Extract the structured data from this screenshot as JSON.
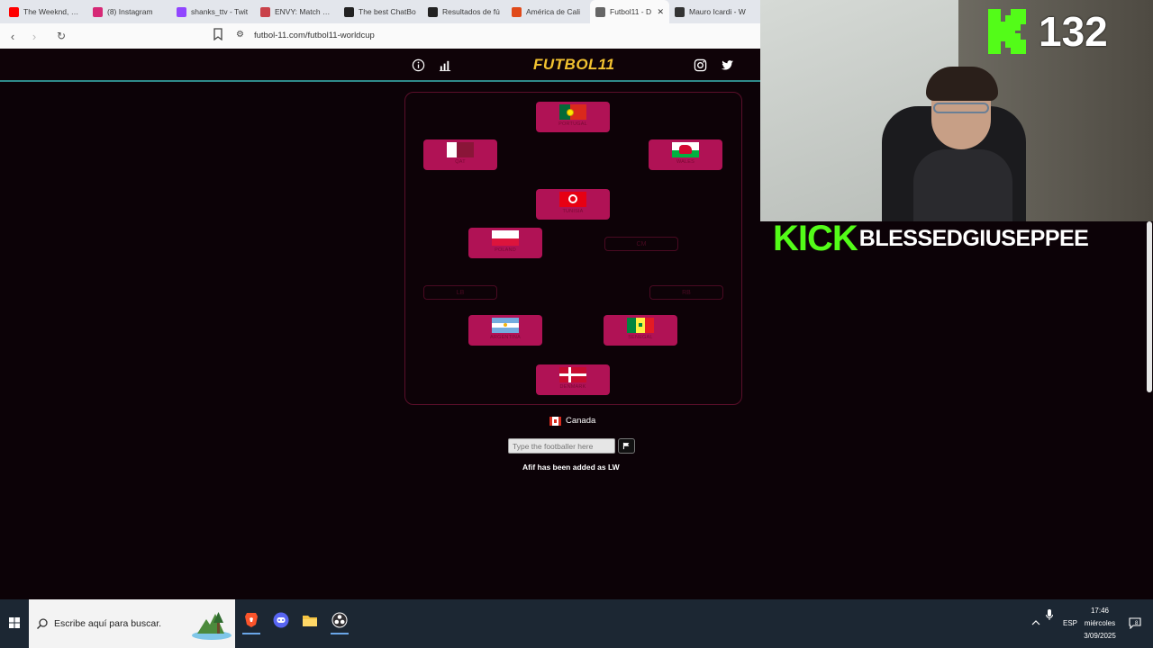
{
  "browser": {
    "tabs": [
      {
        "label": "The Weeknd, Pla",
        "icon": "youtube-icon",
        "color": "#ff0000"
      },
      {
        "label": "(8) Instagram",
        "icon": "instagram-icon",
        "color": "#d62976"
      },
      {
        "label": "shanks_ttv - Twit",
        "icon": "twitch-icon",
        "color": "#9146ff"
      },
      {
        "label": "ENVY: Match Res",
        "icon": "valorant-icon",
        "color": "#c9424a"
      },
      {
        "label": "The best ChatBo",
        "icon": "chatbot-icon",
        "color": "#222222"
      },
      {
        "label": "Resultados de fú",
        "icon": "results-icon",
        "color": "#222222"
      },
      {
        "label": "América de Cali",
        "icon": "america-icon",
        "color": "#e04a1a"
      },
      {
        "label": "Futbol11 - D",
        "icon": "globe-icon",
        "color": "#666666",
        "active": true
      },
      {
        "label": "Mauro Icardi - W",
        "icon": "wikipedia-icon",
        "color": "#333333"
      }
    ],
    "url": "futbol-11.com/futbol11-worldcup"
  },
  "site": {
    "logo": "FUTBOL11",
    "logo_color": "#f2c230",
    "accent": "#b01255",
    "pitch_slots": [
      {
        "flag": "portugal",
        "player": "PORTUGAL"
      },
      {
        "flag": "qatar",
        "player": "QAT"
      },
      {
        "flag": "wales",
        "player": "WALES"
      },
      {
        "flag": "tunisia",
        "player": "TUNISIA"
      },
      {
        "flag": "poland",
        "player": "POLAND"
      },
      {
        "flag": "argentina",
        "player": "ARGENTINA"
      },
      {
        "flag": "senegal",
        "player": "SENEGAL"
      },
      {
        "flag": "denmark",
        "player": "DENMARK"
      }
    ],
    "empty_positions": [
      {
        "label": "CM"
      },
      {
        "label": "LB"
      },
      {
        "label": "RB"
      }
    ],
    "nation": "Canada",
    "search_placeholder": "Type the footballer here",
    "status": "Afif has been added as LW"
  },
  "stream": {
    "viewer_count": "132",
    "kick_word": "KICK",
    "channel_name": "BLESSEDGIUSEPPEE",
    "kick_color": "#53fc18"
  },
  "taskbar": {
    "search_text": "Escribe aquí para buscar.",
    "language": "ESP",
    "time": "17:46",
    "day": "miércoles",
    "date": "3/09/2025",
    "notification_count": "8"
  }
}
